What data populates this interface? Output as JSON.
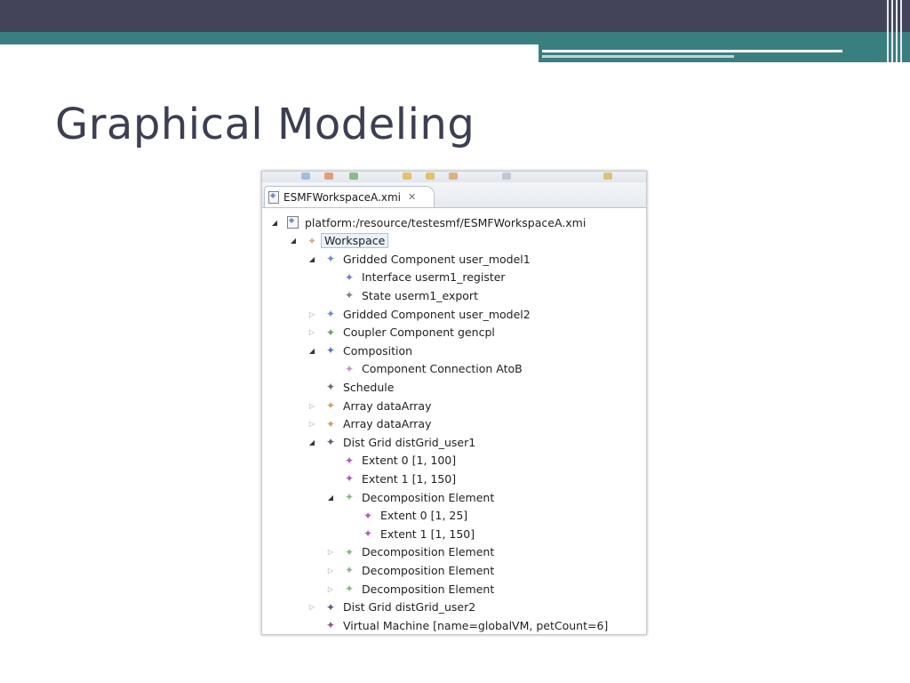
{
  "slide": {
    "title": "Graphical Modeling"
  },
  "editor": {
    "tab_label": "ESMFWorkspaceA.xmi",
    "tab_close_glyph": "✕",
    "tree": [
      {
        "label": "platform:/resource/testesmf/ESMFWorkspaceA.xmi",
        "depth": 0,
        "state": "open",
        "icon": "xmi-resource-icon",
        "color": "#7b8cc2"
      },
      {
        "label": "Workspace",
        "depth": 1,
        "state": "open",
        "icon": "workspace-icon",
        "color": "#c9b48a",
        "selected": true
      },
      {
        "label": "Gridded Component user_model1",
        "depth": 2,
        "state": "open",
        "icon": "gridded-component-icon",
        "color": "#6e8fc4"
      },
      {
        "label": "Interface userm1_register",
        "depth": 3,
        "state": "none",
        "icon": "interface-icon",
        "color": "#7080c0"
      },
      {
        "label": "State userm1_export",
        "depth": 3,
        "state": "none",
        "icon": "state-icon",
        "color": "#8a7a7a"
      },
      {
        "label": "Gridded Component user_model2",
        "depth": 2,
        "state": "closed",
        "icon": "gridded-component-icon",
        "color": "#6e8fc4"
      },
      {
        "label": "Coupler Component gencpl",
        "depth": 2,
        "state": "closed",
        "icon": "coupler-component-icon",
        "color": "#6f9a72"
      },
      {
        "label": "Composition",
        "depth": 2,
        "state": "open",
        "icon": "composition-icon",
        "color": "#5a78b8"
      },
      {
        "label": "Component Connection AtoB",
        "depth": 3,
        "state": "none",
        "icon": "connection-icon",
        "color": "#c494c9"
      },
      {
        "label": "Schedule",
        "depth": 2,
        "state": "none",
        "icon": "schedule-icon",
        "color": "#6a6a6a"
      },
      {
        "label": "Array dataArray",
        "depth": 2,
        "state": "closed",
        "icon": "array-icon",
        "color": "#c9a070"
      },
      {
        "label": "Array dataArray",
        "depth": 2,
        "state": "closed",
        "icon": "array-icon",
        "color": "#c9a070"
      },
      {
        "label": "Dist Grid distGrid_user1",
        "depth": 2,
        "state": "open",
        "icon": "distgrid-icon",
        "color": "#5c5a7e"
      },
      {
        "label": "Extent 0 [1, 100]",
        "depth": 3,
        "state": "none",
        "icon": "extent-icon",
        "color": "#b05bb8"
      },
      {
        "label": "Extent 1 [1, 150]",
        "depth": 3,
        "state": "none",
        "icon": "extent-icon",
        "color": "#b05bb8"
      },
      {
        "label": "Decomposition Element",
        "depth": 3,
        "state": "open",
        "icon": "decomposition-icon",
        "color": "#8fb38f"
      },
      {
        "label": "Extent 0 [1, 25]",
        "depth": 4,
        "state": "none",
        "icon": "extent-icon",
        "color": "#b05bb8"
      },
      {
        "label": "Extent 1 [1, 150]",
        "depth": 4,
        "state": "none",
        "icon": "extent-icon",
        "color": "#b05bb8"
      },
      {
        "label": "Decomposition Element",
        "depth": 3,
        "state": "closed",
        "icon": "decomposition-icon",
        "color": "#8fb38f"
      },
      {
        "label": "Decomposition Element",
        "depth": 3,
        "state": "closed",
        "icon": "decomposition-icon",
        "color": "#8fb38f"
      },
      {
        "label": "Decomposition Element",
        "depth": 3,
        "state": "closed",
        "icon": "decomposition-icon",
        "color": "#8fb38f"
      },
      {
        "label": "Dist Grid distGrid_user2",
        "depth": 2,
        "state": "closed",
        "icon": "distgrid-icon",
        "color": "#5c5a7e"
      },
      {
        "label": "Virtual Machine [name=globalVM, petCount=6]",
        "depth": 2,
        "state": "none",
        "icon": "virtual-machine-icon",
        "color": "#8a5a86"
      }
    ]
  }
}
